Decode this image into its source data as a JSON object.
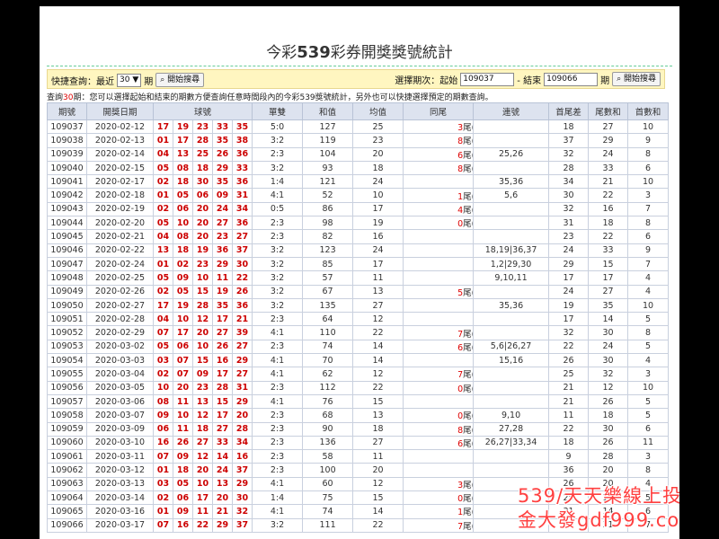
{
  "title_prefix": "今彩",
  "title_num": "539",
  "title_suffix": "彩券開獎獎號統計",
  "quick": {
    "label": "快捷查詢：最近",
    "select": "30 ▼",
    "unit": "期",
    "search": "開始搜尋",
    "period_label": "選擇期次：起始",
    "start": "109037",
    "end_label": "- 結束",
    "end": "109066",
    "unit2": "期",
    "search2": "開始搜尋"
  },
  "note": {
    "pre": "查詢",
    "count": "30",
    "text": "期：您可以選擇起始和結束的期數方便查詢任意時間段內的今彩539獎號統計，另外也可以快捷選擇預定的期數查詢。"
  },
  "headers": [
    "期號",
    "開獎日期",
    "球號",
    "單雙",
    "和值",
    "均值",
    "同尾",
    "連號",
    "首尾差",
    "尾數和",
    "首數和"
  ],
  "rows": [
    [
      "109037",
      "2020-02-12",
      [
        "17",
        "19",
        "23",
        "33",
        "35"
      ],
      "5:0",
      "127",
      "25",
      "3尾(2)",
      "",
      "18",
      "27",
      "10"
    ],
    [
      "109038",
      "2020-02-13",
      [
        "01",
        "17",
        "28",
        "35",
        "38"
      ],
      "3:2",
      "119",
      "23",
      "8尾(2)",
      "",
      "37",
      "29",
      "9"
    ],
    [
      "109039",
      "2020-02-14",
      [
        "04",
        "13",
        "25",
        "26",
        "36"
      ],
      "2:3",
      "104",
      "20",
      "6尾(2)",
      "25,26",
      "32",
      "24",
      "8"
    ],
    [
      "109040",
      "2020-02-15",
      [
        "05",
        "08",
        "18",
        "29",
        "33"
      ],
      "3:2",
      "93",
      "18",
      "8尾(2)",
      "",
      "28",
      "33",
      "6"
    ],
    [
      "109041",
      "2020-02-17",
      [
        "02",
        "18",
        "30",
        "35",
        "36"
      ],
      "1:4",
      "121",
      "24",
      "",
      "35,36",
      "34",
      "21",
      "10"
    ],
    [
      "109042",
      "2020-02-18",
      [
        "01",
        "05",
        "06",
        "09",
        "31"
      ],
      "4:1",
      "52",
      "10",
      "1尾(2)",
      "5,6",
      "30",
      "22",
      "3"
    ],
    [
      "109043",
      "2020-02-19",
      [
        "02",
        "06",
        "20",
        "24",
        "34"
      ],
      "0:5",
      "86",
      "17",
      "4尾(2)",
      "",
      "32",
      "16",
      "7"
    ],
    [
      "109044",
      "2020-02-20",
      [
        "05",
        "10",
        "20",
        "27",
        "36"
      ],
      "2:3",
      "98",
      "19",
      "0尾(2)",
      "",
      "31",
      "18",
      "8"
    ],
    [
      "109045",
      "2020-02-21",
      [
        "04",
        "08",
        "20",
        "23",
        "27"
      ],
      "2:3",
      "82",
      "16",
      "",
      "",
      "23",
      "22",
      "6"
    ],
    [
      "109046",
      "2020-02-22",
      [
        "13",
        "18",
        "19",
        "36",
        "37"
      ],
      "3:2",
      "123",
      "24",
      "",
      "18,19|36,37",
      "24",
      "33",
      "9"
    ],
    [
      "109047",
      "2020-02-24",
      [
        "01",
        "02",
        "23",
        "29",
        "30"
      ],
      "3:2",
      "85",
      "17",
      "",
      "1,2|29,30",
      "29",
      "15",
      "7"
    ],
    [
      "109048",
      "2020-02-25",
      [
        "05",
        "09",
        "10",
        "11",
        "22"
      ],
      "3:2",
      "57",
      "11",
      "",
      "9,10,11",
      "17",
      "17",
      "4"
    ],
    [
      "109049",
      "2020-02-26",
      [
        "02",
        "05",
        "15",
        "19",
        "26"
      ],
      "3:2",
      "67",
      "13",
      "5尾(2)",
      "",
      "24",
      "27",
      "4"
    ],
    [
      "109050",
      "2020-02-27",
      [
        "17",
        "19",
        "28",
        "35",
        "36"
      ],
      "3:2",
      "135",
      "27",
      "",
      "35,36",
      "19",
      "35",
      "10"
    ],
    [
      "109051",
      "2020-02-28",
      [
        "04",
        "10",
        "12",
        "17",
        "21"
      ],
      "2:3",
      "64",
      "12",
      "",
      "",
      "17",
      "14",
      "5"
    ],
    [
      "109052",
      "2020-02-29",
      [
        "07",
        "17",
        "20",
        "27",
        "39"
      ],
      "4:1",
      "110",
      "22",
      "7尾(3)",
      "",
      "32",
      "30",
      "8"
    ],
    [
      "109053",
      "2020-03-02",
      [
        "05",
        "06",
        "10",
        "26",
        "27"
      ],
      "2:3",
      "74",
      "14",
      "6尾(2)",
      "5,6|26,27",
      "22",
      "24",
      "5"
    ],
    [
      "109054",
      "2020-03-03",
      [
        "03",
        "07",
        "15",
        "16",
        "29"
      ],
      "4:1",
      "70",
      "14",
      "",
      "15,16",
      "26",
      "30",
      "4"
    ],
    [
      "109055",
      "2020-03-04",
      [
        "02",
        "07",
        "09",
        "17",
        "27"
      ],
      "4:1",
      "62",
      "12",
      "7尾(3)",
      "",
      "25",
      "32",
      "3"
    ],
    [
      "109056",
      "2020-03-05",
      [
        "10",
        "20",
        "23",
        "28",
        "31"
      ],
      "2:3",
      "112",
      "22",
      "0尾(2)",
      "",
      "21",
      "12",
      "10"
    ],
    [
      "109057",
      "2020-03-06",
      [
        "08",
        "11",
        "13",
        "15",
        "29"
      ],
      "4:1",
      "76",
      "15",
      "",
      "",
      "21",
      "26",
      "5"
    ],
    [
      "109058",
      "2020-03-07",
      [
        "09",
        "10",
        "12",
        "17",
        "20"
      ],
      "2:3",
      "68",
      "13",
      "0尾(2)",
      "9,10",
      "11",
      "18",
      "5"
    ],
    [
      "109059",
      "2020-03-09",
      [
        "06",
        "11",
        "18",
        "27",
        "28"
      ],
      "2:3",
      "90",
      "18",
      "8尾(2)",
      "27,28",
      "22",
      "30",
      "6"
    ],
    [
      "109060",
      "2020-03-10",
      [
        "16",
        "26",
        "27",
        "33",
        "34"
      ],
      "2:3",
      "136",
      "27",
      "6尾(2)",
      "26,27|33,34",
      "18",
      "26",
      "11"
    ],
    [
      "109061",
      "2020-03-11",
      [
        "07",
        "09",
        "12",
        "14",
        "16"
      ],
      "2:3",
      "58",
      "11",
      "",
      "",
      "9",
      "28",
      "3"
    ],
    [
      "109062",
      "2020-03-12",
      [
        "01",
        "18",
        "20",
        "24",
        "37"
      ],
      "2:3",
      "100",
      "20",
      "",
      "",
      "36",
      "20",
      "8"
    ],
    [
      "109063",
      "2020-03-13",
      [
        "03",
        "05",
        "10",
        "13",
        "29"
      ],
      "4:1",
      "60",
      "12",
      "3尾(2)",
      "",
      "26",
      "20",
      "4"
    ],
    [
      "109064",
      "2020-03-14",
      [
        "02",
        "06",
        "17",
        "20",
        "30"
      ],
      "1:4",
      "75",
      "15",
      "0尾(2)",
      "",
      "28",
      "15",
      "5"
    ],
    [
      "109065",
      "2020-03-16",
      [
        "01",
        "09",
        "11",
        "21",
        "32"
      ],
      "4:1",
      "74",
      "14",
      "1尾(3)",
      "",
      "31",
      "14",
      "6"
    ],
    [
      "109066",
      "2020-03-17",
      [
        "07",
        "16",
        "22",
        "29",
        "37"
      ],
      "3:2",
      "111",
      "22",
      "7尾(2)",
      "",
      "30",
      "31",
      "7"
    ]
  ],
  "watermark": {
    "line1": "539/天天樂線上投注",
    "line2": "金大發gdf999.com",
    "color": "#ff4040"
  }
}
